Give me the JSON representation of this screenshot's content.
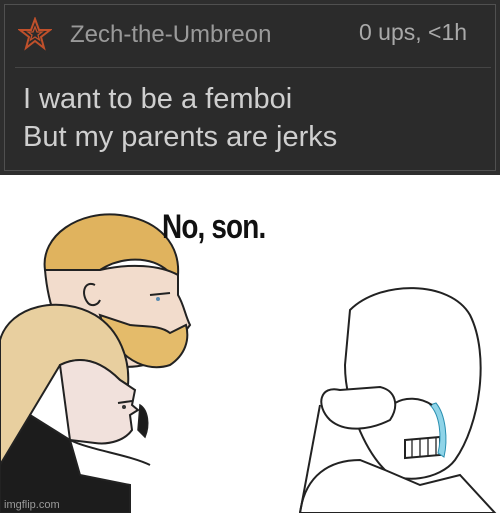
{
  "comment": {
    "username": "Zech-the-Umbreon",
    "meta": "0 ups, <1h",
    "lines": [
      "I want to be a femboi",
      "But my parents are jerks"
    ],
    "badge_icon": "star-icon",
    "badge_color": "#c0502b"
  },
  "meme": {
    "caption": "No, son.",
    "watermark": "imgflip.com"
  }
}
